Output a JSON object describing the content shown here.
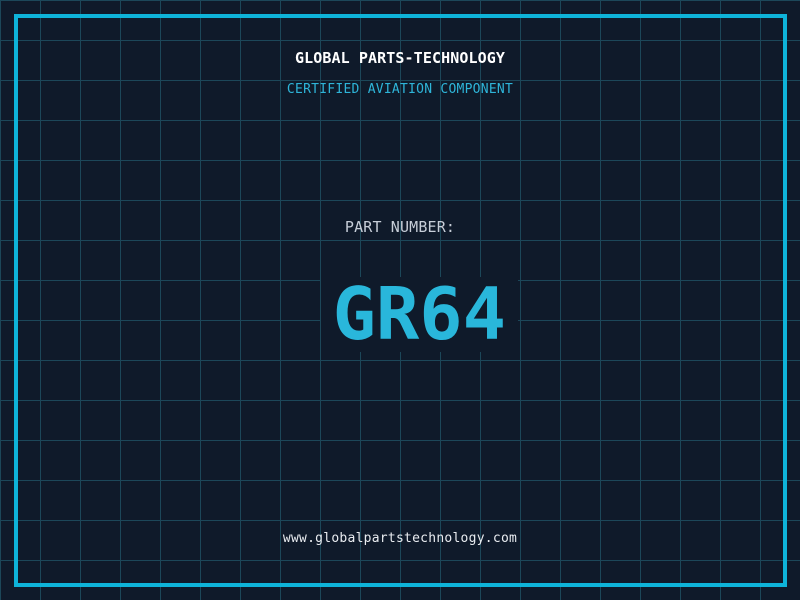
{
  "header": {
    "title": "GLOBAL PARTS-TECHNOLOGY",
    "subtitle": "CERTIFIED AVIATION COMPONENT"
  },
  "part": {
    "label": "PART NUMBER:",
    "value": "GR64"
  },
  "footer": {
    "website": "www.globalpartstechnology.com"
  },
  "colors": {
    "background": "#0f1a2a",
    "grid_line": "#1c4759",
    "frame_border": "#0eb3d9",
    "title_text": "#ffffff",
    "subtitle_text": "#2eb5d9",
    "part_label_text": "#c7ced8",
    "part_value_text": "#29b7db",
    "website_text": "#e9ecf0"
  }
}
